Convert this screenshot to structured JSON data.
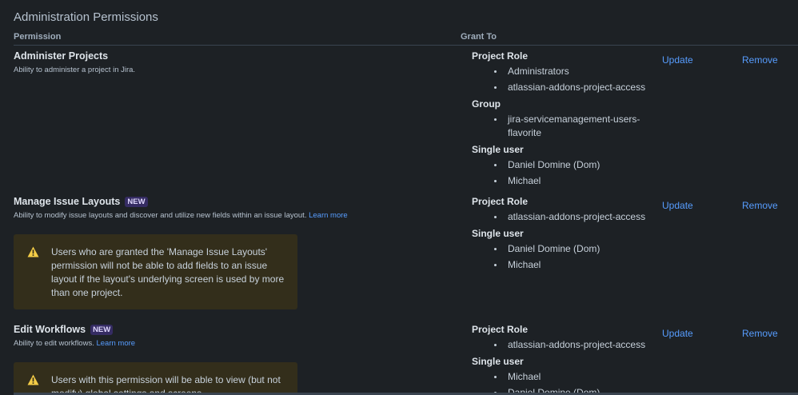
{
  "section": {
    "title": "Administration Permissions",
    "col_permission": "Permission",
    "col_grant_to": "Grant To"
  },
  "actions": {
    "update": "Update",
    "remove": "Remove"
  },
  "permissions": [
    {
      "name": "Administer Projects",
      "description": "Ability to administer a project in Jira.",
      "grants": [
        {
          "type": "Project Role",
          "items": [
            "Administrators",
            "atlassian-addons-project-access"
          ]
        },
        {
          "type": "Group",
          "items": [
            "jira-servicemanagement-users-flavorite"
          ]
        },
        {
          "type": "Single user",
          "items": [
            "Daniel Domine (Dom)",
            "Michael"
          ]
        }
      ]
    },
    {
      "name": "Manage Issue Layouts",
      "badge": "NEW",
      "description": "Ability to modify issue layouts and discover and utilize new fields within an issue layout.",
      "learn_more": "Learn more",
      "warning": "Users who are granted the 'Manage Issue Layouts' permission will not be able to add fields to an issue layout if the layout's underlying screen is used by more than one project.",
      "grants": [
        {
          "type": "Project Role",
          "items": [
            "atlassian-addons-project-access"
          ]
        },
        {
          "type": "Single user",
          "items": [
            "Daniel Domine (Dom)",
            "Michael"
          ]
        }
      ]
    },
    {
      "name": "Edit Workflows",
      "badge": "NEW",
      "description": "Ability to edit workflows.",
      "learn_more": "Learn more",
      "warning": "Users with this permission will be able to view (but not modify) global settings and screens.",
      "grants": [
        {
          "type": "Project Role",
          "items": [
            "atlassian-addons-project-access"
          ]
        },
        {
          "type": "Single user",
          "items": [
            "Michael",
            "Daniel Domine (Dom)"
          ]
        }
      ]
    }
  ],
  "colors": {
    "background": "#1d2125",
    "link": "#579dff",
    "warning_bg": "#332e1b",
    "warning_icon": "#f5cd47",
    "badge_bg": "#352c63"
  },
  "icons": {
    "warning": "warning-icon"
  }
}
